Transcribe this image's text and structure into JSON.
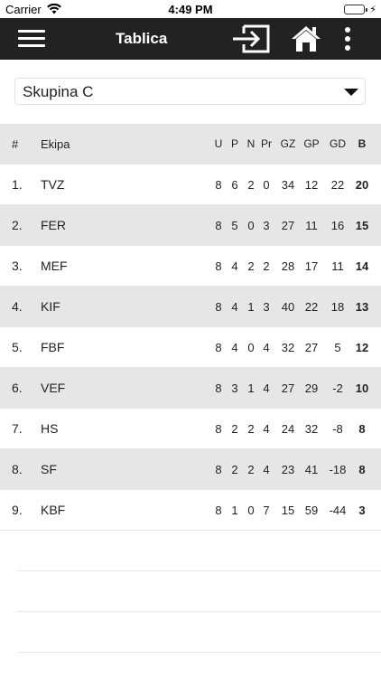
{
  "status_bar": {
    "carrier": "Carrier",
    "time": "4:49 PM",
    "icons": [
      "wifi-icon",
      "battery-icon",
      "charging-bolt-icon"
    ],
    "battery_color": "#4cd964"
  },
  "app_bar": {
    "title": "Tablica",
    "background": "#222222",
    "icons": [
      "menu-icon",
      "login-icon",
      "home-icon",
      "more-vertical-icon"
    ]
  },
  "group_select": {
    "value": "Skupina C",
    "icon": "chevron-down-icon"
  },
  "table": {
    "columns": {
      "rank": "#",
      "team": "Ekipa",
      "u": "U",
      "p": "P",
      "n": "N",
      "pr": "Pr",
      "gz": "GZ",
      "gp": "GP",
      "gd": "GD",
      "b": "B"
    },
    "rows": [
      {
        "rank": "1.",
        "team": "TVZ",
        "u": "8",
        "p": "6",
        "n": "2",
        "pr": "0",
        "gz": "34",
        "gp": "12",
        "gd": "22",
        "b": "20"
      },
      {
        "rank": "2.",
        "team": "FER",
        "u": "8",
        "p": "5",
        "n": "0",
        "pr": "3",
        "gz": "27",
        "gp": "11",
        "gd": "16",
        "b": "15"
      },
      {
        "rank": "3.",
        "team": "MEF",
        "u": "8",
        "p": "4",
        "n": "2",
        "pr": "2",
        "gz": "28",
        "gp": "17",
        "gd": "11",
        "b": "14"
      },
      {
        "rank": "4.",
        "team": "KIF",
        "u": "8",
        "p": "4",
        "n": "1",
        "pr": "3",
        "gz": "40",
        "gp": "22",
        "gd": "18",
        "b": "13"
      },
      {
        "rank": "5.",
        "team": "FBF",
        "u": "8",
        "p": "4",
        "n": "0",
        "pr": "4",
        "gz": "32",
        "gp": "27",
        "gd": "5",
        "b": "12"
      },
      {
        "rank": "6.",
        "team": "VEF",
        "u": "8",
        "p": "3",
        "n": "1",
        "pr": "4",
        "gz": "27",
        "gp": "29",
        "gd": "-2",
        "b": "10"
      },
      {
        "rank": "7.",
        "team": "HS",
        "u": "8",
        "p": "2",
        "n": "2",
        "pr": "4",
        "gz": "24",
        "gp": "32",
        "gd": "-8",
        "b": "8"
      },
      {
        "rank": "8.",
        "team": "SF",
        "u": "8",
        "p": "2",
        "n": "2",
        "pr": "4",
        "gz": "23",
        "gp": "41",
        "gd": "-18",
        "b": "8"
      },
      {
        "rank": "9.",
        "team": "KBF",
        "u": "8",
        "p": "1",
        "n": "0",
        "pr": "7",
        "gz": "15",
        "gp": "59",
        "gd": "-44",
        "b": "3"
      }
    ],
    "shaded_row_color": "#e6e6e6"
  }
}
